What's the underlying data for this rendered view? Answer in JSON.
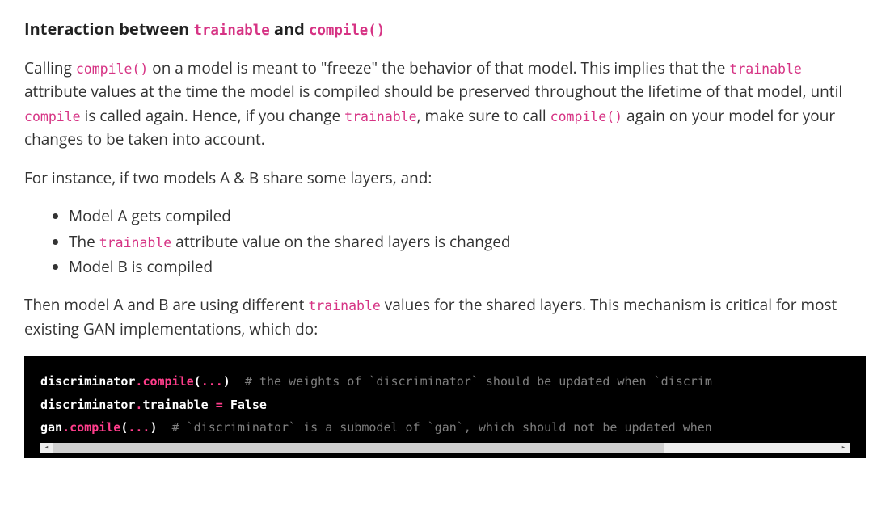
{
  "heading": {
    "t0": "Interaction between ",
    "c0": "trainable",
    "t1": " and ",
    "c1": "compile()"
  },
  "para1": {
    "t0": "Calling ",
    "c0": "compile()",
    "t1": " on a model is meant to \"freeze\" the behavior of that model. This implies that the ",
    "c1": "trainable",
    "t2": " attribute values at the time the model is compiled should be preserved throughout the lifetime of that model, until ",
    "c2": "compile",
    "t3": " is called again. Hence, if you change ",
    "c3": "trainable",
    "t4": ", make sure to call ",
    "c4": "compile()",
    "t5": " again on your model for your changes to be taken into account."
  },
  "para2": "For instance, if two models A & B share some layers, and:",
  "list": {
    "li0": "Model A gets compiled",
    "li1_t0": "The ",
    "li1_c0": "trainable",
    "li1_t1": " attribute value on the shared layers is changed",
    "li2": "Model B is compiled"
  },
  "para3": {
    "t0": "Then model A and B are using different ",
    "c0": "trainable",
    "t1": " values for the shared layers. This mechanism is critical for most existing GAN implementations, which do:"
  },
  "code": {
    "l1": {
      "name0": "discriminator",
      "dot0": ".",
      "func0": "compile",
      "paren0": "(",
      "arg0": "...",
      "paren1": ")",
      "sp0": "  ",
      "comm0": "# the weights of `discriminator` should be updated when `discrim"
    },
    "l2": {
      "name0": "discriminator",
      "dot0": ".",
      "name1": "trainable",
      "sp0": " ",
      "op0": "=",
      "sp1": " ",
      "kw0": "False"
    },
    "l3": {
      "name0": "gan",
      "dot0": ".",
      "func0": "compile",
      "paren0": "(",
      "arg0": "...",
      "paren1": ")",
      "sp0": "  ",
      "comm0": "# `discriminator` is a submodel of `gan`, which should not be updated when"
    }
  }
}
